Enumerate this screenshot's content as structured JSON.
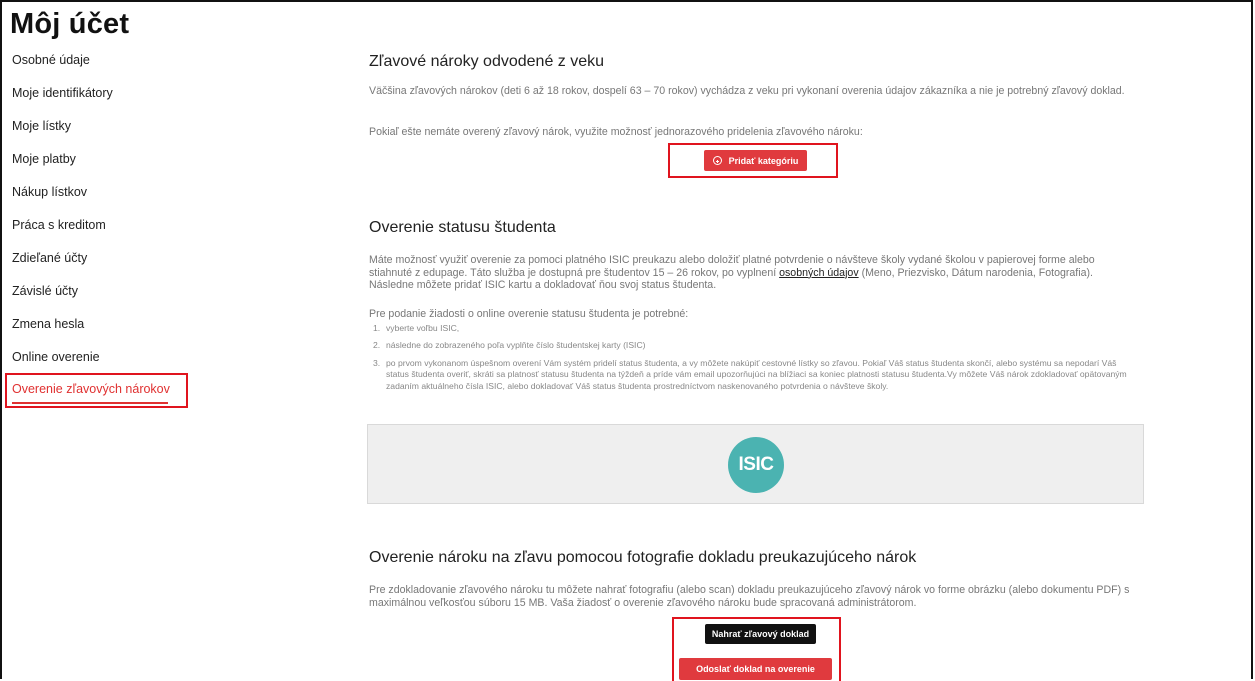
{
  "page": {
    "title": "Môj účet"
  },
  "sidebar": {
    "items": [
      {
        "label": "Osobné údaje"
      },
      {
        "label": "Moje identifikátory"
      },
      {
        "label": "Moje lístky"
      },
      {
        "label": "Moje platby"
      },
      {
        "label": "Nákup lístkov"
      },
      {
        "label": "Práca s kreditom"
      },
      {
        "label": "Zdieľané účty"
      },
      {
        "label": "Závislé účty"
      },
      {
        "label": "Zmena hesla"
      },
      {
        "label": "Online overenie"
      },
      {
        "label": "Overenie zľavových nárokov",
        "active": true
      }
    ]
  },
  "age_section": {
    "title": "Zľavové nároky odvodené z veku",
    "para1": "Väčšina zľavových nárokov (deti 6 až 18 rokov, dospelí 63 – 70 rokov) vychádza z veku pri vykonaní overenia údajov zákazníka a nie je potrebný zľavový doklad.",
    "para2": "Pokiaľ ešte nemáte overený zľavový nárok, využite možnosť jednorazového pridelenia zľavového nároku:",
    "button": "Pridať kategóriu"
  },
  "student_section": {
    "title": "Overenie statusu študenta",
    "para1_before": "Máte možnosť využiť overenie za pomoci platného ISIC preukazu alebo doložiť platné potvrdenie o návšteve školy vydané školou v papierovej forme alebo stiahnuté z edupage. Táto služba je dostupná pre študentov 15 – 26 rokov, po vyplnení ",
    "para1_link": "osobných údajov",
    "para1_after": " (Meno, Priezvisko, Dátum narodenia, Fotografia). Následne môžete pridať ISIC kartu a dokladovať ňou svoj status študenta.",
    "para2": "Pre podanie žiadosti o online overenie statusu študenta je potrebné:",
    "steps": [
      {
        "num": "1.",
        "text": "vyberte voľbu ISIC,"
      },
      {
        "num": "2.",
        "text": "následne do zobrazeného poľa vyplňte číslo študentskej karty (ISIC)"
      },
      {
        "num": "3.",
        "text": "po prvom vykonanom úspešnom overení Vám systém pridelí status študenta, a vy môžete nakúpiť cestovné lístky so zľavou. Pokiaľ Váš status študenta skončí, alebo systému sa nepodarí Váš status študenta overiť, skráti sa platnosť statusu študenta na týždeň a príde vám email upozorňujúci na blížiaci sa koniec platnosti statusu študenta.Vy môžete Váš nárok zdokladovať opätovaným zadaním aktuálneho čísla ISIC, alebo dokladovať Váš status študenta prostredníctvom naskenovaného potvrdenia o návšteve školy."
      }
    ],
    "isic_logo": "ISIC"
  },
  "photo_section": {
    "title": "Overenie nároku na zľavu pomocou fotografie dokladu preukazujúceho nárok",
    "para": "Pre zdokladovanie zľavového nároku tu môžete nahrať fotografiu (alebo scan) dokladu preukazujúceho zľavový nárok vo forme obrázku (alebo dokumentu PDF) s maximálnou veľkosťou súboru 15 MB. Vaša žiadosť o overenie zľavového nároku bude spracovaná administrátorom.",
    "upload_button": "Nahrať zľavový doklad",
    "submit_button": "Odoslať doklad na overenie"
  },
  "colors": {
    "accent": "#e03a3e",
    "highlight_box": "#e0141e",
    "isic": "#4bb3b1"
  }
}
